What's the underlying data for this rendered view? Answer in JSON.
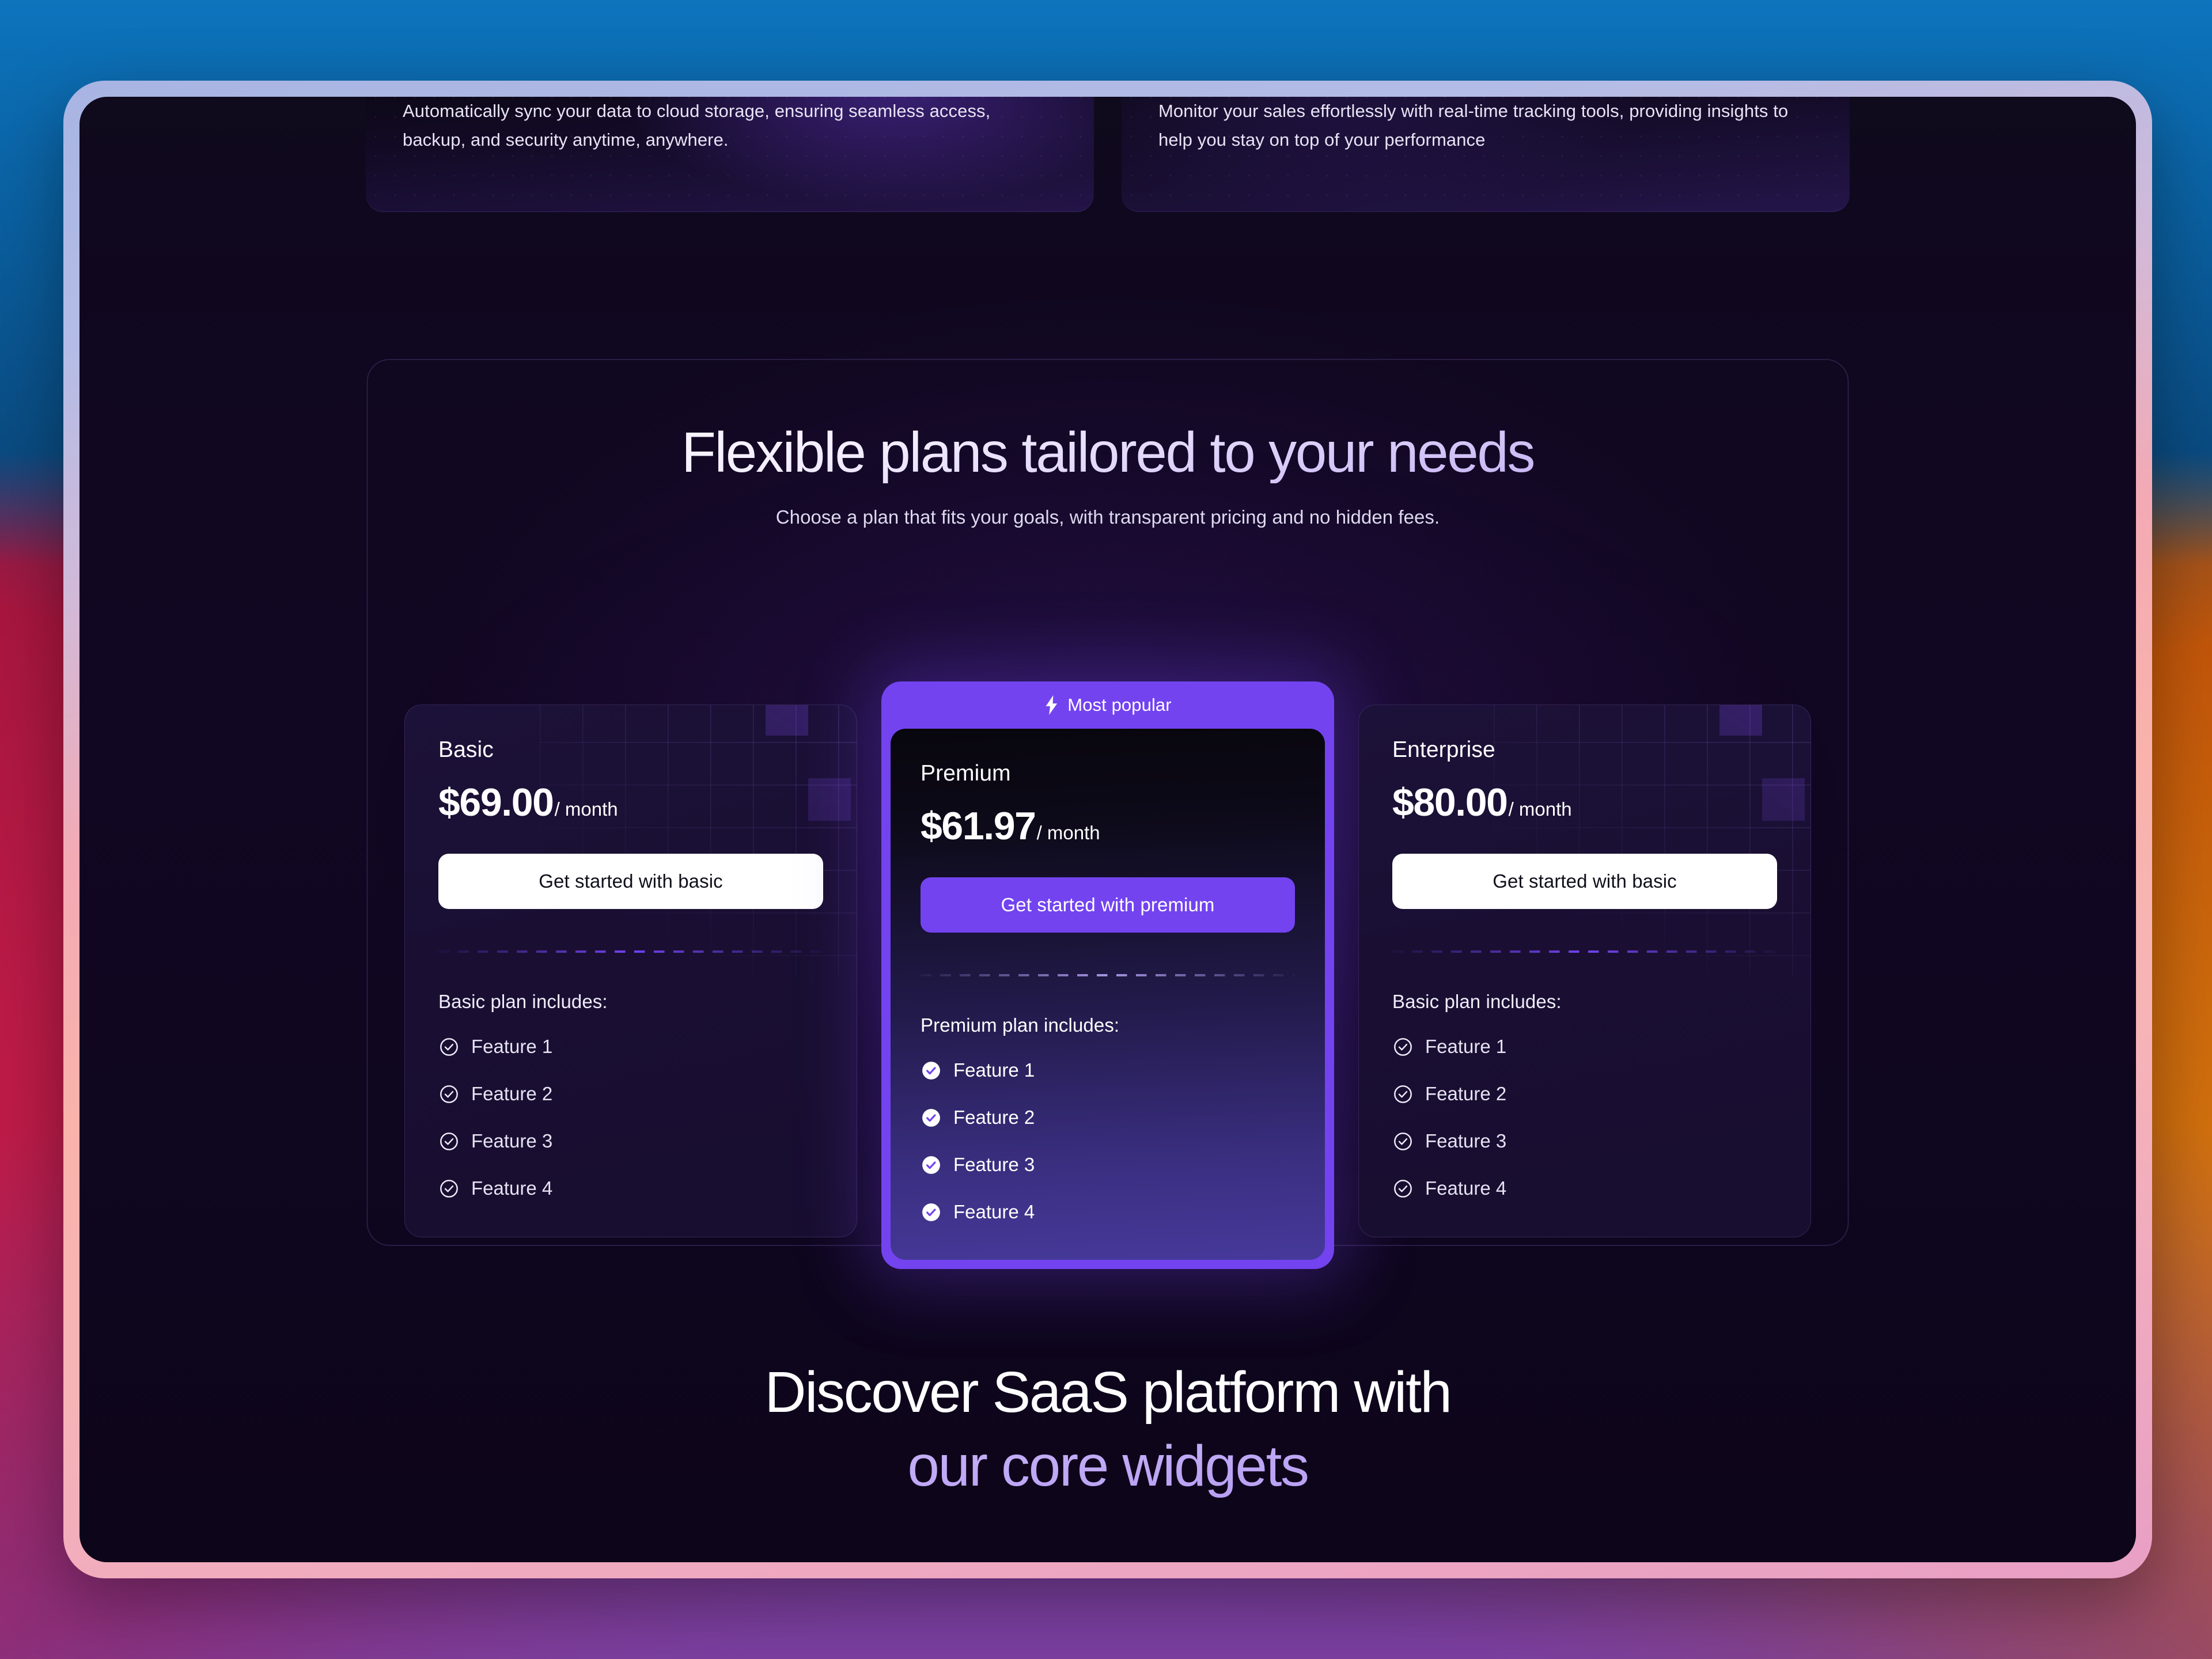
{
  "top_feature_cards": [
    {
      "text": "Automatically sync your data to cloud storage, ensuring seamless access, backup, and security anytime, anywhere."
    },
    {
      "text": "Monitor your sales effortlessly with real-time tracking tools, providing insights to help you stay on top of your performance"
    }
  ],
  "pricing": {
    "title": "Flexible plans tailored to your needs",
    "subtitle": "Choose a plan that fits your goals, with transparent pricing and no hidden fees.",
    "popular_badge": "Most popular",
    "plans": [
      {
        "name": "Basic",
        "price": "$69.00",
        "period": "/ month",
        "cta": "Get started with basic",
        "includes_label": "Basic plan includes:",
        "features": [
          "Feature 1",
          "Feature 2",
          "Feature 3",
          "Feature 4"
        ]
      },
      {
        "name": "Premium",
        "price": "$61.97",
        "period": "/ month",
        "cta": "Get started with premium",
        "includes_label": "Premium plan includes:",
        "features": [
          "Feature 1",
          "Feature 2",
          "Feature 3",
          "Feature 4"
        ]
      },
      {
        "name": "Enterprise",
        "price": "$80.00",
        "period": "/ month",
        "cta": "Get started with basic",
        "includes_label": "Basic plan includes:",
        "features": [
          "Feature 1",
          "Feature 2",
          "Feature 3",
          "Feature 4"
        ]
      }
    ]
  },
  "bottom_headline": {
    "line1": "Discover SaaS platform with",
    "line2": "our core widgets"
  },
  "colors": {
    "accent_purple": "#7343f0",
    "card_background": "#1a0f33",
    "page_background": "#100722",
    "cta_white": "#ffffff",
    "heading_gradient_start": "#ffffff",
    "heading_gradient_end": "#b79ff0"
  }
}
